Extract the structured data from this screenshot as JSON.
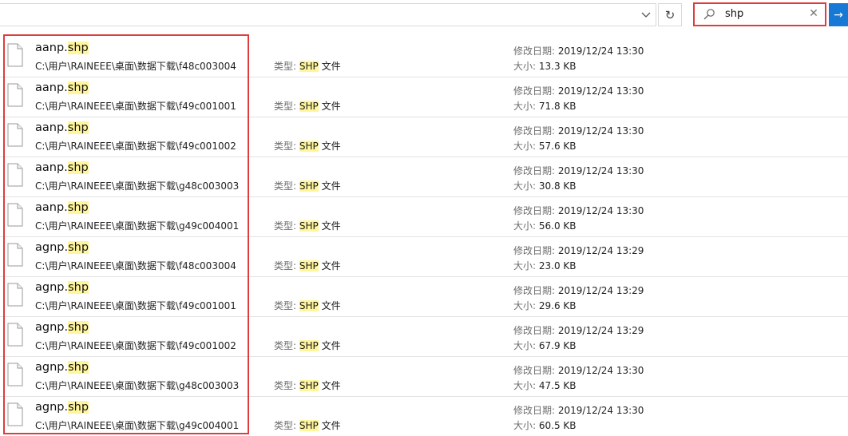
{
  "toolbar": {
    "refresh_icon": "refresh-icon",
    "search_value": "shp",
    "search_icon": "search-icon",
    "clear_icon": "close-icon",
    "go_icon": "arrow-right-icon"
  },
  "labels": {
    "date": "修改日期:",
    "size": "大小:",
    "type": "类型:",
    "type_suffix": "文件"
  },
  "files": [
    {
      "name_base": "aanp.",
      "name_ext": "shp",
      "path": "C:\\用户\\RAINEEE\\桌面\\数据下载\\f48c003004",
      "type": "SHP",
      "date": "2019/12/24 13:30",
      "size": "13.3 KB"
    },
    {
      "name_base": "aanp.",
      "name_ext": "shp",
      "path": "C:\\用户\\RAINEEE\\桌面\\数据下载\\f49c001001",
      "type": "SHP",
      "date": "2019/12/24 13:30",
      "size": "71.8 KB"
    },
    {
      "name_base": "aanp.",
      "name_ext": "shp",
      "path": "C:\\用户\\RAINEEE\\桌面\\数据下载\\f49c001002",
      "type": "SHP",
      "date": "2019/12/24 13:30",
      "size": "57.6 KB"
    },
    {
      "name_base": "aanp.",
      "name_ext": "shp",
      "path": "C:\\用户\\RAINEEE\\桌面\\数据下载\\g48c003003",
      "type": "SHP",
      "date": "2019/12/24 13:30",
      "size": "30.8 KB"
    },
    {
      "name_base": "aanp.",
      "name_ext": "shp",
      "path": "C:\\用户\\RAINEEE\\桌面\\数据下载\\g49c004001",
      "type": "SHP",
      "date": "2019/12/24 13:30",
      "size": "56.0 KB"
    },
    {
      "name_base": "agnp.",
      "name_ext": "shp",
      "path": "C:\\用户\\RAINEEE\\桌面\\数据下载\\f48c003004",
      "type": "SHP",
      "date": "2019/12/24 13:29",
      "size": "23.0 KB"
    },
    {
      "name_base": "agnp.",
      "name_ext": "shp",
      "path": "C:\\用户\\RAINEEE\\桌面\\数据下载\\f49c001001",
      "type": "SHP",
      "date": "2019/12/24 13:29",
      "size": "29.6 KB"
    },
    {
      "name_base": "agnp.",
      "name_ext": "shp",
      "path": "C:\\用户\\RAINEEE\\桌面\\数据下载\\f49c001002",
      "type": "SHP",
      "date": "2019/12/24 13:29",
      "size": "67.9 KB"
    },
    {
      "name_base": "agnp.",
      "name_ext": "shp",
      "path": "C:\\用户\\RAINEEE\\桌面\\数据下载\\g48c003003",
      "type": "SHP",
      "date": "2019/12/24 13:30",
      "size": "47.5 KB"
    },
    {
      "name_base": "agnp.",
      "name_ext": "shp",
      "path": "C:\\用户\\RAINEEE\\桌面\\数据下载\\g49c004001",
      "type": "SHP",
      "date": "2019/12/24 13:30",
      "size": "60.5 KB"
    }
  ],
  "colors": {
    "highlight": "#fff59d",
    "annotation_red": "#e03c3c",
    "go_button": "#1779d6"
  }
}
